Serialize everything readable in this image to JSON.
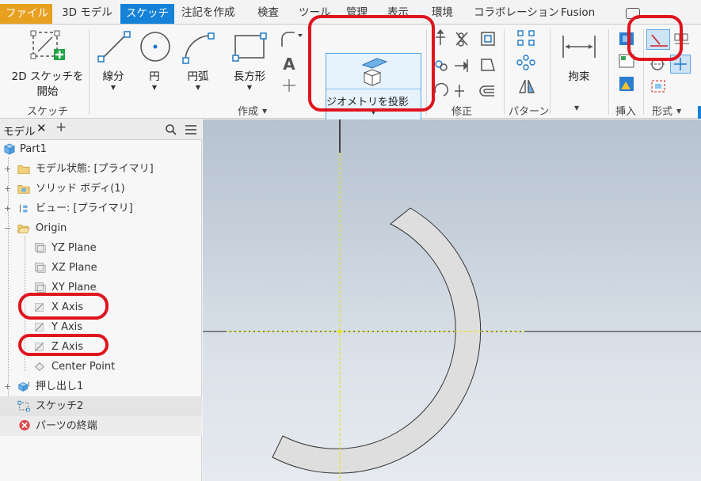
{
  "menu_tabs": [
    {
      "label": "ファイル"
    },
    {
      "label": "3D モデル"
    },
    {
      "label": "スケッチ",
      "active": true
    },
    {
      "label": "注記を作成"
    },
    {
      "label": "検査"
    },
    {
      "label": "ツール"
    },
    {
      "label": "管理"
    },
    {
      "label": "表示"
    },
    {
      "label": "環境"
    },
    {
      "label": "コラボレーション"
    },
    {
      "label": "Fusion"
    }
  ],
  "ribbon": {
    "sketch_panel": {
      "start_2d_sketch_line1": "2D スケッチを",
      "start_2d_sketch_line2": "開始",
      "title": "スケッチ"
    },
    "create_panel": {
      "line": "線分",
      "circle": "円",
      "arc": "円弧",
      "rectangle": "長方形",
      "text_glyph": "A",
      "title": "作成"
    },
    "project_geometry": "ジオメトリを投影",
    "modify_panel": {
      "title": "修正"
    },
    "pattern_panel": {
      "title": "パターン"
    },
    "constrain_panel": {
      "constrain": "拘束"
    },
    "insert_panel": {
      "title": "挿入"
    },
    "format_panel": {
      "title": "形式"
    }
  },
  "browser": {
    "tab_label": "モデル",
    "close_glyph": "✕",
    "add_glyph": "+",
    "items": [
      {
        "label": "Part1"
      },
      {
        "label": "モデル状態: [プライマリ]"
      },
      {
        "label": "ソリッド ボディ(1)"
      },
      {
        "label": "ビュー: [プライマリ]"
      },
      {
        "label": "Origin"
      },
      {
        "label": "YZ Plane"
      },
      {
        "label": "XZ Plane"
      },
      {
        "label": "XY Plane"
      },
      {
        "label": "X Axis"
      },
      {
        "label": "Y Axis"
      },
      {
        "label": "Z Axis"
      },
      {
        "label": "Center Point"
      },
      {
        "label": "押し出し1"
      },
      {
        "label": "スケッチ2"
      },
      {
        "label": "パーツの終端"
      }
    ]
  },
  "colors": {
    "file_tab": "#e8a020",
    "active_tab": "#1582d8",
    "annotation_red": "#e0141e",
    "projected_axis": "#e6e600",
    "viewport_top": "#b6c2cf",
    "viewport_bottom": "#e6eaf0"
  }
}
